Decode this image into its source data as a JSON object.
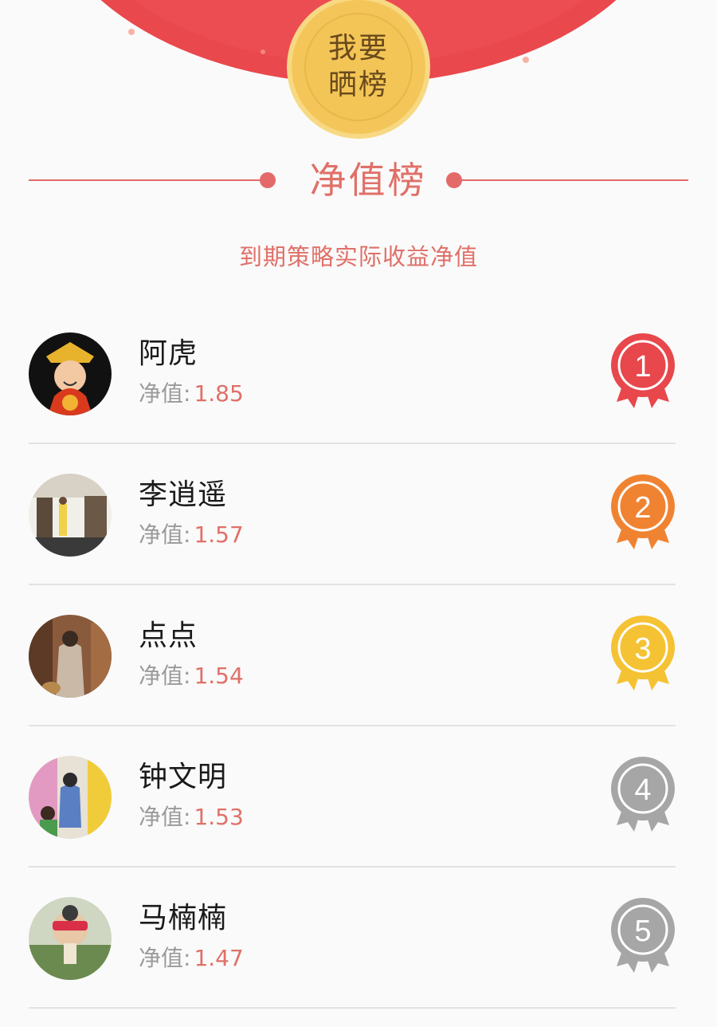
{
  "header": {
    "show_button_label": "我要晒榜"
  },
  "board": {
    "title": "净值榜",
    "subtitle": "到期策略实际收益净值",
    "nav_label": "净值:"
  },
  "entries": [
    {
      "rank": "1",
      "name": "阿虎",
      "nav": "1.85",
      "medal_color": "#e8474c"
    },
    {
      "rank": "2",
      "name": "李逍遥",
      "nav": "1.57",
      "medal_color": "#f08332"
    },
    {
      "rank": "3",
      "name": "点点",
      "nav": "1.54",
      "medal_color": "#f5c233"
    },
    {
      "rank": "4",
      "name": "钟文明",
      "nav": "1.53",
      "medal_color": "#a6a6a6"
    },
    {
      "rank": "5",
      "name": "马楠楠",
      "nav": "1.47",
      "medal_color": "#a6a6a6"
    }
  ],
  "colors": {
    "accent": "#e07068",
    "header_red": "#e8474c",
    "button_gold": "#f4c65a"
  }
}
